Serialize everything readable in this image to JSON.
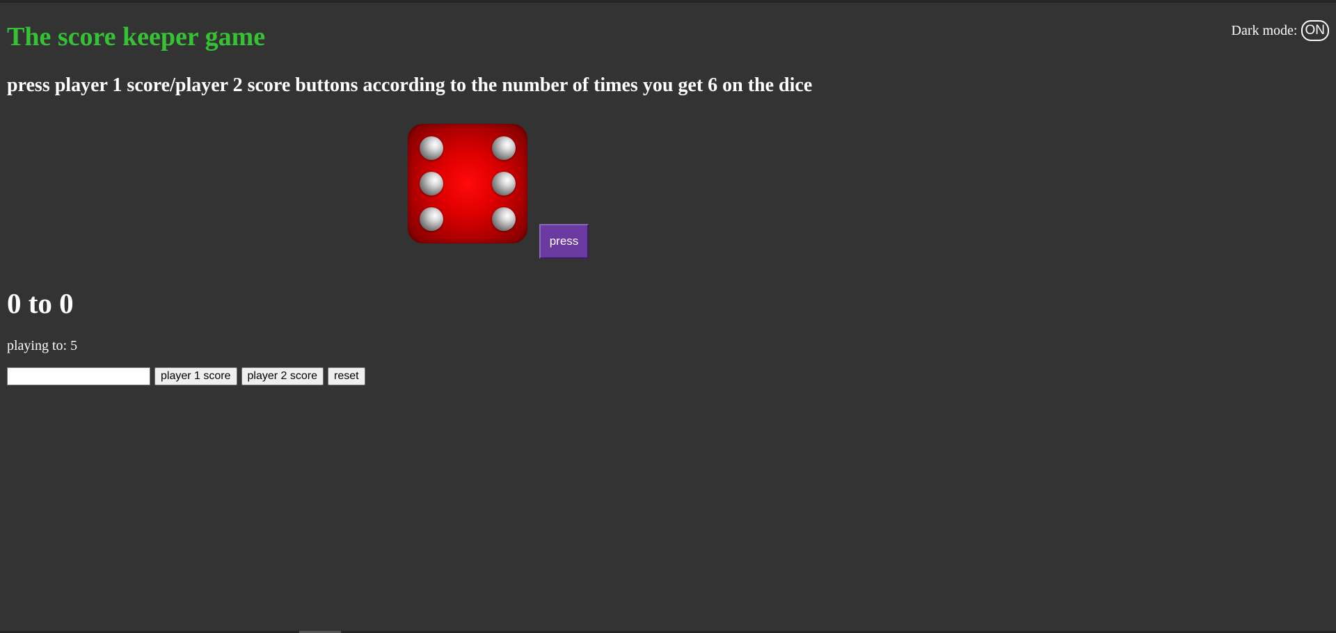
{
  "header": {
    "title": "The score keeper game",
    "instructions": "press player 1 score/player 2 score buttons according to the number of times you get 6 on the dice"
  },
  "dark_mode": {
    "label": "Dark mode:",
    "state": "ON"
  },
  "dice": {
    "value": 6,
    "color": "#e00000"
  },
  "press_button": {
    "label": "press",
    "color": "#6a3aa0"
  },
  "score": {
    "display": "0 to 0",
    "player1": 0,
    "player2": 0
  },
  "playing_to": {
    "text": "playing to: 5",
    "value": 5
  },
  "controls": {
    "input_value": "",
    "player1_label": "player 1 score",
    "player2_label": "player 2 score",
    "reset_label": "reset"
  },
  "colors": {
    "background": "#333333",
    "title": "#35c235"
  }
}
